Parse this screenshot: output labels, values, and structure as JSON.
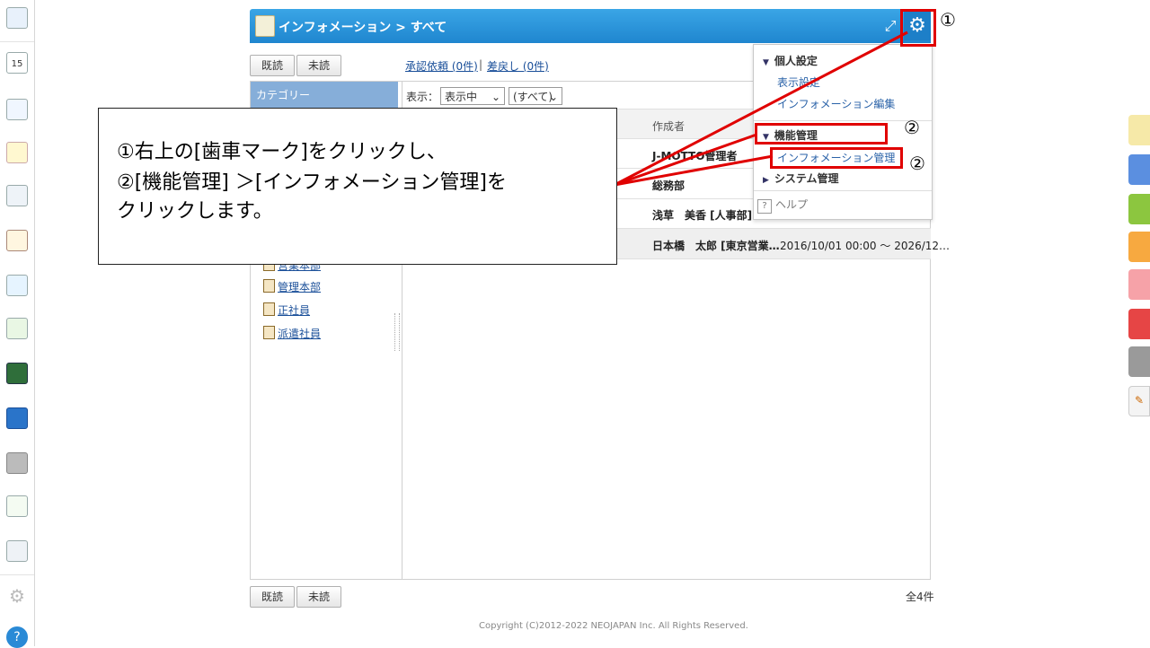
{
  "header": {
    "title": "インフォメーション > すべて"
  },
  "toolbar": {
    "read_btn": "既読",
    "unread_btn": "未読",
    "approval_link": "承認依頼 (0件)",
    "separator": "|",
    "returned_link": "差戻し (0件)"
  },
  "category": {
    "heading": "カテゴリー",
    "items": [
      "営業本部",
      "管理本部",
      "正社員",
      "派遣社員"
    ]
  },
  "filter": {
    "label": "表示：",
    "display_value": "表示中",
    "scope_value": "(すべて)"
  },
  "list": {
    "author_header": "作成者",
    "rows": [
      {
        "author": "J-MOTTO管理者",
        "period": ""
      },
      {
        "author": "総務部",
        "period": ""
      },
      {
        "author": "浅草　美香 [人事部]",
        "period": ""
      },
      {
        "author": "日本橋　太郎 [東京営業…",
        "period": "2016/10/01 00:00 ～ 2026/12…"
      }
    ]
  },
  "menu": {
    "personal_heading": "個人設定",
    "display_settings": "表示設定",
    "info_edit": "インフォメーション編集",
    "function_heading": "機能管理",
    "info_admin": "インフォメーション管理",
    "system_heading": "システム管理",
    "help": "ヘルプ"
  },
  "callout": {
    "line1": "①右上の[歯車マーク]をクリックし、",
    "line2": "②[機能管理] ＞[インフォメーション管理]を",
    "line3": "クリックします。"
  },
  "markers": {
    "m1": "①",
    "m2a": "②",
    "m2b": "②"
  },
  "bottom": {
    "read_btn": "既読",
    "unread_btn": "未読",
    "total": "全4件"
  },
  "footer": {
    "copyright": "Copyright (C)2012-2022 NEOJAPAN Inc. All Rights Reserved."
  },
  "colors": {
    "header": "#1f86cf",
    "highlight": "#e00000",
    "category_head": "#86aed9"
  },
  "icons": {
    "gear": "gear-icon",
    "expand": "expand-icon",
    "help": "question-icon"
  }
}
